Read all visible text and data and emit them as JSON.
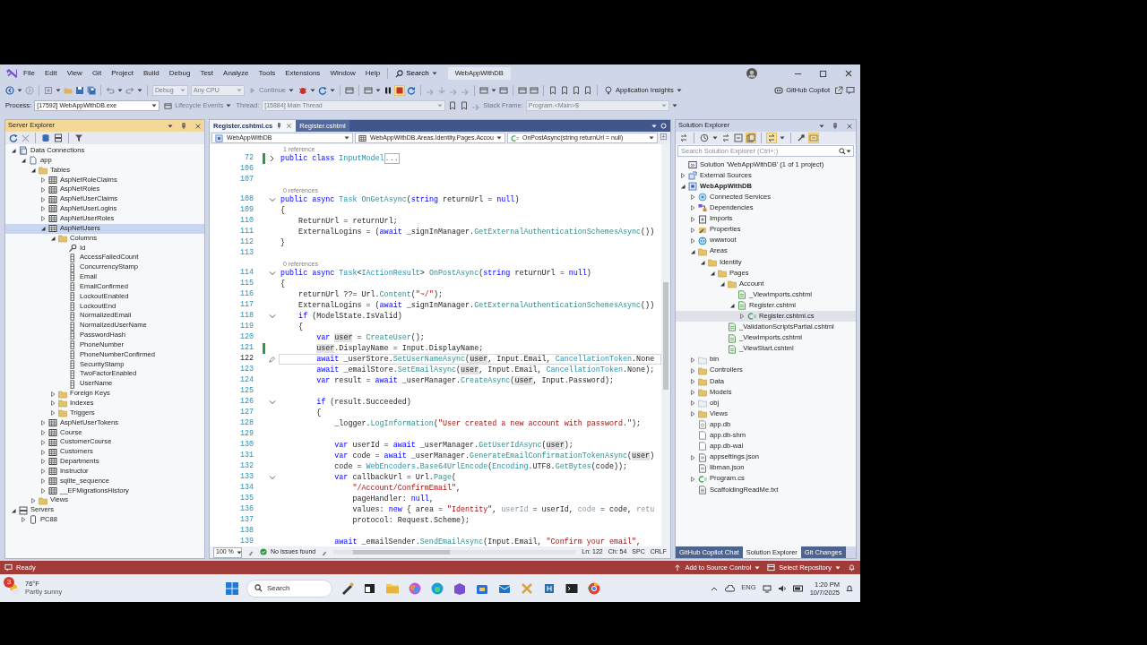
{
  "title_bar": {
    "menu": [
      "File",
      "Edit",
      "View",
      "Git",
      "Project",
      "Build",
      "Debug",
      "Test",
      "Analyze",
      "Tools",
      "Extensions",
      "Window",
      "Help"
    ],
    "search": "Search",
    "solution_name": "WebAppWithDB"
  },
  "toolbar": {
    "configuration": {
      "text": "Debug",
      "disabled": true
    },
    "platform": {
      "text": "Any CPU",
      "disabled": true
    },
    "continue": {
      "text": "Continue",
      "disabled": true
    },
    "insights": "Application Insights",
    "copilot": "GitHub Copilot"
  },
  "debug_toolbar": {
    "process_label": {
      "text": "Process:",
      "disabled": false
    },
    "process": {
      "text": "[17592] WebAppWithDB.exe",
      "disabled": false
    },
    "lifecycle": {
      "text": "Lifecycle Events",
      "disabled": true
    },
    "thread_label": {
      "text": "Thread:",
      "disabled": true
    },
    "thread": {
      "text": "[15884] Main Thread",
      "disabled": true
    },
    "stack_label": {
      "text": "Stack Frame:",
      "disabled": true
    },
    "stack": {
      "text": "Program.<Main>$",
      "disabled": true
    }
  },
  "server_explorer": {
    "title": "Server Explorer",
    "tree": [
      {
        "label": "Data Connections",
        "kind": "connection",
        "expanded": true,
        "selected": false,
        "children": [
          {
            "label": "app",
            "kind": "database",
            "expanded": true,
            "selected": false,
            "children": [
              {
                "label": "Tables",
                "kind": "folder",
                "expanded": true,
                "selected": false,
                "children": [
                  {
                    "label": "AspNetRoleClaims",
                    "kind": "table",
                    "expanded": false,
                    "selected": false
                  },
                  {
                    "label": "AspNetRoles",
                    "kind": "table",
                    "expanded": false,
                    "selected": false
                  },
                  {
                    "label": "AspNetUserClaims",
                    "kind": "table",
                    "expanded": false,
                    "selected": false
                  },
                  {
                    "label": "AspNetUserLogins",
                    "kind": "table",
                    "expanded": false,
                    "selected": false
                  },
                  {
                    "label": "AspNetUserRoles",
                    "kind": "table",
                    "expanded": false,
                    "selected": false
                  },
                  {
                    "label": "AspNetUsers",
                    "kind": "table",
                    "expanded": true,
                    "selected": true,
                    "children": [
                      {
                        "label": "Columns",
                        "kind": "folder",
                        "expanded": true,
                        "selected": false,
                        "children": [
                          {
                            "label": "Id",
                            "kind": "key",
                            "selected": false
                          },
                          {
                            "label": "AccessFailedCount",
                            "kind": "column",
                            "selected": false
                          },
                          {
                            "label": "ConcurrencyStamp",
                            "kind": "column",
                            "selected": false
                          },
                          {
                            "label": "Email",
                            "kind": "column",
                            "selected": false
                          },
                          {
                            "label": "EmailConfirmed",
                            "kind": "column",
                            "selected": false
                          },
                          {
                            "label": "LockoutEnabled",
                            "kind": "column",
                            "selected": false
                          },
                          {
                            "label": "LockoutEnd",
                            "kind": "column",
                            "selected": false
                          },
                          {
                            "label": "NormalizedEmail",
                            "kind": "column",
                            "selected": false
                          },
                          {
                            "label": "NormalizedUserName",
                            "kind": "column",
                            "selected": false
                          },
                          {
                            "label": "PasswordHash",
                            "kind": "column",
                            "selected": false
                          },
                          {
                            "label": "PhoneNumber",
                            "kind": "column",
                            "selected": false
                          },
                          {
                            "label": "PhoneNumberConfirmed",
                            "kind": "column",
                            "selected": false
                          },
                          {
                            "label": "SecurityStamp",
                            "kind": "column",
                            "selected": false
                          },
                          {
                            "label": "TwoFactorEnabled",
                            "kind": "column",
                            "selected": false
                          },
                          {
                            "label": "UserName",
                            "kind": "column",
                            "selected": false
                          }
                        ]
                      },
                      {
                        "label": "Foreign Keys",
                        "kind": "folder",
                        "expanded": false,
                        "selected": false
                      },
                      {
                        "label": "Indexes",
                        "kind": "folder",
                        "expanded": false,
                        "selected": false
                      },
                      {
                        "label": "Triggers",
                        "kind": "folder",
                        "expanded": false,
                        "selected": false
                      }
                    ]
                  },
                  {
                    "label": "AspNetUserTokens",
                    "kind": "table",
                    "expanded": false,
                    "selected": false
                  },
                  {
                    "label": "Course",
                    "kind": "table",
                    "expanded": false,
                    "selected": false
                  },
                  {
                    "label": "CustomerCourse",
                    "kind": "table",
                    "expanded": false,
                    "selected": false
                  },
                  {
                    "label": "Customers",
                    "kind": "table",
                    "expanded": false,
                    "selected": false
                  },
                  {
                    "label": "Departments",
                    "kind": "table",
                    "expanded": false,
                    "selected": false
                  },
                  {
                    "label": "Instructor",
                    "kind": "table",
                    "expanded": false,
                    "selected": false
                  },
                  {
                    "label": "sqlite_sequence",
                    "kind": "table",
                    "expanded": false,
                    "selected": false
                  },
                  {
                    "label": "__EFMigrationsHistory",
                    "kind": "table",
                    "expanded": false,
                    "selected": false
                  }
                ]
              },
              {
                "label": "Views",
                "kind": "folder",
                "expanded": false,
                "selected": false
              }
            ]
          }
        ]
      },
      {
        "label": "Servers",
        "kind": "server",
        "expanded": true,
        "selected": false,
        "children": [
          {
            "label": "PC88",
            "kind": "computer",
            "expanded": false,
            "selected": false
          }
        ]
      }
    ]
  },
  "editor": {
    "tabs": [
      {
        "label": "Register.cshtml.cs",
        "selected": true
      },
      {
        "label": "Register.cshtml",
        "selected": false
      }
    ],
    "nav": [
      "WebAppWithDB",
      "WebAppWithDB.Areas.Identity.Pages.Accou",
      "OnPostAsync(string returnUrl = null)"
    ],
    "lines": [
      {
        "kind": "lens",
        "text": "1 reference"
      },
      {
        "kind": "code",
        "number": "72",
        "expanded": false,
        "changed": true,
        "tokens": [
          {
            "kind": "keyword",
            "text": "public class "
          },
          {
            "kind": "type",
            "text": "InputModel"
          },
          {
            "kind": "collapsed",
            "text": "..."
          }
        ]
      },
      {
        "kind": "code",
        "number": "106"
      },
      {
        "kind": "code",
        "number": "107"
      },
      {
        "kind": "lens",
        "text": "0 references"
      },
      {
        "kind": "code",
        "number": "108",
        "expanded": true,
        "tokens": [
          {
            "kind": "keyword",
            "text": "public async "
          },
          {
            "kind": "type",
            "text": "Task "
          },
          {
            "kind": "method",
            "text": "OnGetAsync"
          },
          {
            "kind": "plain",
            "text": "("
          },
          {
            "kind": "keyword",
            "text": "string "
          },
          {
            "kind": "plain",
            "text": "returnUrl = "
          },
          {
            "kind": "keyword",
            "text": "null"
          },
          {
            "kind": "plain",
            "text": ")"
          }
        ]
      },
      {
        "kind": "code",
        "number": "109",
        "tokens": [
          {
            "kind": "plain",
            "text": "{"
          }
        ]
      },
      {
        "kind": "code",
        "number": "110",
        "tokens": [
          {
            "kind": "plain",
            "text": "    ReturnUrl = returnUrl;"
          }
        ]
      },
      {
        "kind": "code",
        "number": "111",
        "tokens": [
          {
            "kind": "plain",
            "text": "    ExternalLogins = ("
          },
          {
            "kind": "keyword",
            "text": "await "
          },
          {
            "kind": "plain",
            "text": "_signInManager."
          },
          {
            "kind": "method",
            "text": "GetExternalAuthenticationSchemesAsync"
          },
          {
            "kind": "plain",
            "text": "())"
          }
        ]
      },
      {
        "kind": "code",
        "number": "112",
        "tokens": [
          {
            "kind": "plain",
            "text": "}"
          }
        ]
      },
      {
        "kind": "code",
        "number": "113"
      },
      {
        "kind": "lens",
        "text": "0 references"
      },
      {
        "kind": "code",
        "number": "114",
        "expanded": true,
        "tokens": [
          {
            "kind": "keyword",
            "text": "public async "
          },
          {
            "kind": "type",
            "text": "Task"
          },
          {
            "kind": "plain",
            "text": "<"
          },
          {
            "kind": "type",
            "text": "IActionResult"
          },
          {
            "kind": "plain",
            "text": "> "
          },
          {
            "kind": "method",
            "text": "OnPostAsync"
          },
          {
            "kind": "plain",
            "text": "("
          },
          {
            "kind": "keyword",
            "text": "string "
          },
          {
            "kind": "plain",
            "text": "returnUrl = "
          },
          {
            "kind": "keyword",
            "text": "null"
          },
          {
            "kind": "plain",
            "text": ")"
          }
        ]
      },
      {
        "kind": "code",
        "number": "115",
        "tokens": [
          {
            "kind": "plain",
            "text": "{"
          }
        ]
      },
      {
        "kind": "code",
        "number": "116",
        "tokens": [
          {
            "kind": "plain",
            "text": "    returnUrl ??= Url."
          },
          {
            "kind": "method",
            "text": "Content"
          },
          {
            "kind": "plain",
            "text": "("
          },
          {
            "kind": "string",
            "text": "\"~/\""
          },
          {
            "kind": "plain",
            "text": ");"
          }
        ]
      },
      {
        "kind": "code",
        "number": "117",
        "tokens": [
          {
            "kind": "plain",
            "text": "    ExternalLogins = ("
          },
          {
            "kind": "keyword",
            "text": "await "
          },
          {
            "kind": "plain",
            "text": "_signInManager."
          },
          {
            "kind": "method",
            "text": "GetExternalAuthenticationSchemesAsync"
          },
          {
            "kind": "plain",
            "text": "())"
          }
        ]
      },
      {
        "kind": "code",
        "number": "118",
        "expanded": true,
        "tokens": [
          {
            "kind": "keyword",
            "text": "    if "
          },
          {
            "kind": "plain",
            "text": "(ModelState.IsValid)"
          }
        ]
      },
      {
        "kind": "code",
        "number": "119",
        "tokens": [
          {
            "kind": "plain",
            "text": "    {"
          }
        ]
      },
      {
        "kind": "code",
        "number": "120",
        "tokens": [
          {
            "kind": "keyword",
            "text": "        var "
          },
          {
            "kind": "reference",
            "text": "user"
          },
          {
            "kind": "plain",
            "text": " = "
          },
          {
            "kind": "method",
            "text": "CreateUser"
          },
          {
            "kind": "plain",
            "text": "();"
          }
        ]
      },
      {
        "kind": "code",
        "number": "121",
        "changed": true,
        "tokens": [
          {
            "kind": "reference",
            "text": "        user"
          },
          {
            "kind": "plain",
            "text": ".DisplayName = Input.DisplayName;"
          }
        ]
      },
      {
        "kind": "code",
        "number": "122",
        "current": true,
        "tokens": [
          {
            "kind": "keyword",
            "text": "        await "
          },
          {
            "kind": "plain",
            "text": "_userStore."
          },
          {
            "kind": "method",
            "text": "SetUserNameAsync"
          },
          {
            "kind": "plain",
            "text": "("
          },
          {
            "kind": "reference",
            "text": "user"
          },
          {
            "kind": "plain",
            "text": ", Input.Email, "
          },
          {
            "kind": "type",
            "text": "CancellationToken"
          },
          {
            "kind": "plain",
            "text": ".None"
          }
        ]
      },
      {
        "kind": "code",
        "number": "123",
        "tokens": [
          {
            "kind": "keyword",
            "text": "        await "
          },
          {
            "kind": "plain",
            "text": "_emailStore."
          },
          {
            "kind": "method",
            "text": "SetEmailAsync"
          },
          {
            "kind": "plain",
            "text": "("
          },
          {
            "kind": "reference",
            "text": "user"
          },
          {
            "kind": "plain",
            "text": ", Input.Email, "
          },
          {
            "kind": "type",
            "text": "CancellationToken"
          },
          {
            "kind": "plain",
            "text": ".None);"
          }
        ]
      },
      {
        "kind": "code",
        "number": "124",
        "tokens": [
          {
            "kind": "keyword",
            "text": "        var "
          },
          {
            "kind": "plain",
            "text": "result = "
          },
          {
            "kind": "keyword",
            "text": "await "
          },
          {
            "kind": "plain",
            "text": "_userManager."
          },
          {
            "kind": "method",
            "text": "CreateAsync"
          },
          {
            "kind": "plain",
            "text": "("
          },
          {
            "kind": "reference",
            "text": "user"
          },
          {
            "kind": "plain",
            "text": ", Input.Password);"
          }
        ]
      },
      {
        "kind": "code",
        "number": "125"
      },
      {
        "kind": "code",
        "number": "126",
        "expanded": true,
        "tokens": [
          {
            "kind": "keyword",
            "text": "        if "
          },
          {
            "kind": "plain",
            "text": "(result.Succeeded)"
          }
        ]
      },
      {
        "kind": "code",
        "number": "127",
        "tokens": [
          {
            "kind": "plain",
            "text": "        {"
          }
        ]
      },
      {
        "kind": "code",
        "number": "128",
        "tokens": [
          {
            "kind": "plain",
            "text": "            _logger."
          },
          {
            "kind": "method",
            "text": "LogInformation"
          },
          {
            "kind": "plain",
            "text": "("
          },
          {
            "kind": "string",
            "text": "\"User created a new account with password.\""
          },
          {
            "kind": "plain",
            "text": ");"
          }
        ]
      },
      {
        "kind": "code",
        "number": "129"
      },
      {
        "kind": "code",
        "number": "130",
        "tokens": [
          {
            "kind": "keyword",
            "text": "            var "
          },
          {
            "kind": "plain",
            "text": "userId = "
          },
          {
            "kind": "keyword",
            "text": "await "
          },
          {
            "kind": "plain",
            "text": "_userManager."
          },
          {
            "kind": "method",
            "text": "GetUserIdAsync"
          },
          {
            "kind": "plain",
            "text": "("
          },
          {
            "kind": "reference",
            "text": "user"
          },
          {
            "kind": "plain",
            "text": ");"
          }
        ]
      },
      {
        "kind": "code",
        "number": "131",
        "tokens": [
          {
            "kind": "keyword",
            "text": "            var "
          },
          {
            "kind": "plain",
            "text": "code = "
          },
          {
            "kind": "keyword",
            "text": "await "
          },
          {
            "kind": "plain",
            "text": "_userManager."
          },
          {
            "kind": "method",
            "text": "GenerateEmailConfirmationTokenAsync"
          },
          {
            "kind": "plain",
            "text": "("
          },
          {
            "kind": "reference",
            "text": "user"
          },
          {
            "kind": "plain",
            "text": ")"
          }
        ]
      },
      {
        "kind": "code",
        "number": "132",
        "tokens": [
          {
            "kind": "plain",
            "text": "            code = "
          },
          {
            "kind": "type",
            "text": "WebEncoders"
          },
          {
            "kind": "plain",
            "text": "."
          },
          {
            "kind": "method",
            "text": "Base64UrlEncode"
          },
          {
            "kind": "plain",
            "text": "("
          },
          {
            "kind": "type",
            "text": "Encoding"
          },
          {
            "kind": "plain",
            "text": ".UTF8."
          },
          {
            "kind": "method",
            "text": "GetBytes"
          },
          {
            "kind": "plain",
            "text": "(code));"
          }
        ]
      },
      {
        "kind": "code",
        "number": "133",
        "expanded": true,
        "tokens": [
          {
            "kind": "keyword",
            "text": "            var "
          },
          {
            "kind": "plain",
            "text": "callbackUrl = Url."
          },
          {
            "kind": "method",
            "text": "Page"
          },
          {
            "kind": "plain",
            "text": "("
          }
        ]
      },
      {
        "kind": "code",
        "number": "134",
        "tokens": [
          {
            "kind": "string",
            "text": "                \"/Account/ConfirmEmail\""
          },
          {
            "kind": "plain",
            "text": ","
          }
        ]
      },
      {
        "kind": "code",
        "number": "135",
        "tokens": [
          {
            "kind": "plain",
            "text": "                pageHandler: "
          },
          {
            "kind": "keyword",
            "text": "null"
          },
          {
            "kind": "plain",
            "text": ","
          }
        ]
      },
      {
        "kind": "code",
        "number": "136",
        "tokens": [
          {
            "kind": "plain",
            "text": "                values: "
          },
          {
            "kind": "keyword",
            "text": "new "
          },
          {
            "kind": "plain",
            "text": "{ area = "
          },
          {
            "kind": "string",
            "text": "\"Identity\""
          },
          {
            "kind": "plain",
            "text": ", "
          },
          {
            "kind": "unused",
            "text": "userId"
          },
          {
            "kind": "plain",
            "text": " = userId, "
          },
          {
            "kind": "unused",
            "text": "code"
          },
          {
            "kind": "plain",
            "text": " = code, "
          },
          {
            "kind": "unused",
            "text": "retu"
          }
        ]
      },
      {
        "kind": "code",
        "number": "137",
        "tokens": [
          {
            "kind": "plain",
            "text": "                protocol: Request.Scheme);"
          }
        ]
      },
      {
        "kind": "code",
        "number": "138"
      },
      {
        "kind": "code",
        "number": "139",
        "tokens": [
          {
            "kind": "keyword",
            "text": "            await "
          },
          {
            "kind": "plain",
            "text": "_emailSender."
          },
          {
            "kind": "method",
            "text": "SendEmailAsync"
          },
          {
            "kind": "plain",
            "text": "(Input.Email, "
          },
          {
            "kind": "string",
            "text": "\"Confirm your email\""
          },
          {
            "kind": "plain",
            "text": ","
          }
        ]
      }
    ],
    "zoom": "100 %",
    "issues": "No issues found",
    "line": "Ln: 122",
    "column": "Ch: 54",
    "indent": "SPC",
    "line_ending": "CRLF"
  },
  "solution_explorer": {
    "title": "Solution Explorer",
    "search": {
      "placeholder": "Search Solution Explorer (Ctrl+;)"
    },
    "tree": [
      {
        "label": "Solution 'WebAppWithDB' (1 of 1 project)",
        "kind": "solution",
        "selected": false
      },
      {
        "label": "External Sources",
        "kind": "external",
        "expanded": false,
        "selected": false
      },
      {
        "label": "WebAppWithDB",
        "kind": "project",
        "expanded": true,
        "selected": false,
        "children": [
          {
            "label": "Connected Services",
            "kind": "service",
            "expanded": false,
            "selected": false
          },
          {
            "label": "Dependencies",
            "kind": "dependencies",
            "expanded": false,
            "selected": false
          },
          {
            "label": "Imports",
            "kind": "imports",
            "expanded": false,
            "selected": false
          },
          {
            "label": "Properties",
            "kind": "properties",
            "expanded": false,
            "selected": false
          },
          {
            "label": "wwwroot",
            "kind": "globe",
            "expanded": false,
            "selected": false
          },
          {
            "label": "Areas",
            "kind": "folder",
            "expanded": true,
            "selected": false,
            "children": [
              {
                "label": "Identity",
                "kind": "folder",
                "expanded": true,
                "selected": false,
                "children": [
                  {
                    "label": "Pages",
                    "kind": "folder",
                    "expanded": true,
                    "selected": false,
                    "children": [
                      {
                        "label": "Account",
                        "kind": "folder",
                        "expanded": true,
                        "selected": false,
                        "children": [
                          {
                            "label": "_ViewImports.cshtml",
                            "kind": "razor",
                            "selected": false
                          },
                          {
                            "label": "Register.cshtml",
                            "kind": "razor",
                            "expanded": true,
                            "selected": false,
                            "children": [
                              {
                                "label": "Register.cshtml.cs",
                                "kind": "csharp",
                                "expanded": false,
                                "selected": true
                              }
                            ]
                          }
                        ]
                      },
                      {
                        "label": "_ValidationScriptsPartial.cshtml",
                        "kind": "razor",
                        "selected": false
                      },
                      {
                        "label": "_ViewImports.cshtml",
                        "kind": "razor",
                        "selected": false
                      },
                      {
                        "label": "_ViewStart.cshtml",
                        "kind": "razor",
                        "selected": false
                      }
                    ]
                  }
                ]
              }
            ]
          },
          {
            "label": "bin",
            "kind": "folder_empty",
            "expanded": false,
            "selected": false
          },
          {
            "label": "Controllers",
            "kind": "folder",
            "expanded": false,
            "selected": false
          },
          {
            "label": "Data",
            "kind": "folder",
            "expanded": false,
            "selected": false
          },
          {
            "label": "Models",
            "kind": "folder",
            "expanded": false,
            "selected": false
          },
          {
            "label": "obj",
            "kind": "folder_empty",
            "expanded": false,
            "selected": false
          },
          {
            "label": "Views",
            "kind": "folder",
            "expanded": false,
            "selected": false
          },
          {
            "label": "app.db",
            "kind": "database_file",
            "selected": false
          },
          {
            "label": "app.db-shm",
            "kind": "file",
            "selected": false
          },
          {
            "label": "app.db-wal",
            "kind": "file",
            "selected": false
          },
          {
            "label": "appsettings.json",
            "kind": "json",
            "expanded": false,
            "selected": false
          },
          {
            "label": "libman.json",
            "kind": "json",
            "selected": false
          },
          {
            "label": "Program.cs",
            "kind": "csharp",
            "expanded": false,
            "selected": false
          },
          {
            "label": "ScaffoldingReadMe.txt",
            "kind": "text",
            "selected": false
          }
        ]
      }
    ],
    "tabs": [
      {
        "label": "GitHub Copilot Chat",
        "selected": false
      },
      {
        "label": "Solution Explorer",
        "selected": true
      },
      {
        "label": "Git Changes",
        "selected": false
      }
    ]
  },
  "status_bar": {
    "state": "Ready",
    "source_control": "Add to Source Control",
    "repository": "Select Repository"
  },
  "taskbar": {
    "weather": {
      "badge": "3",
      "temperature": "76°F",
      "condition": "Partly sunny"
    },
    "search": "Search",
    "language": "ENG",
    "time": "1:20 PM",
    "date": "10/7/2025"
  }
}
